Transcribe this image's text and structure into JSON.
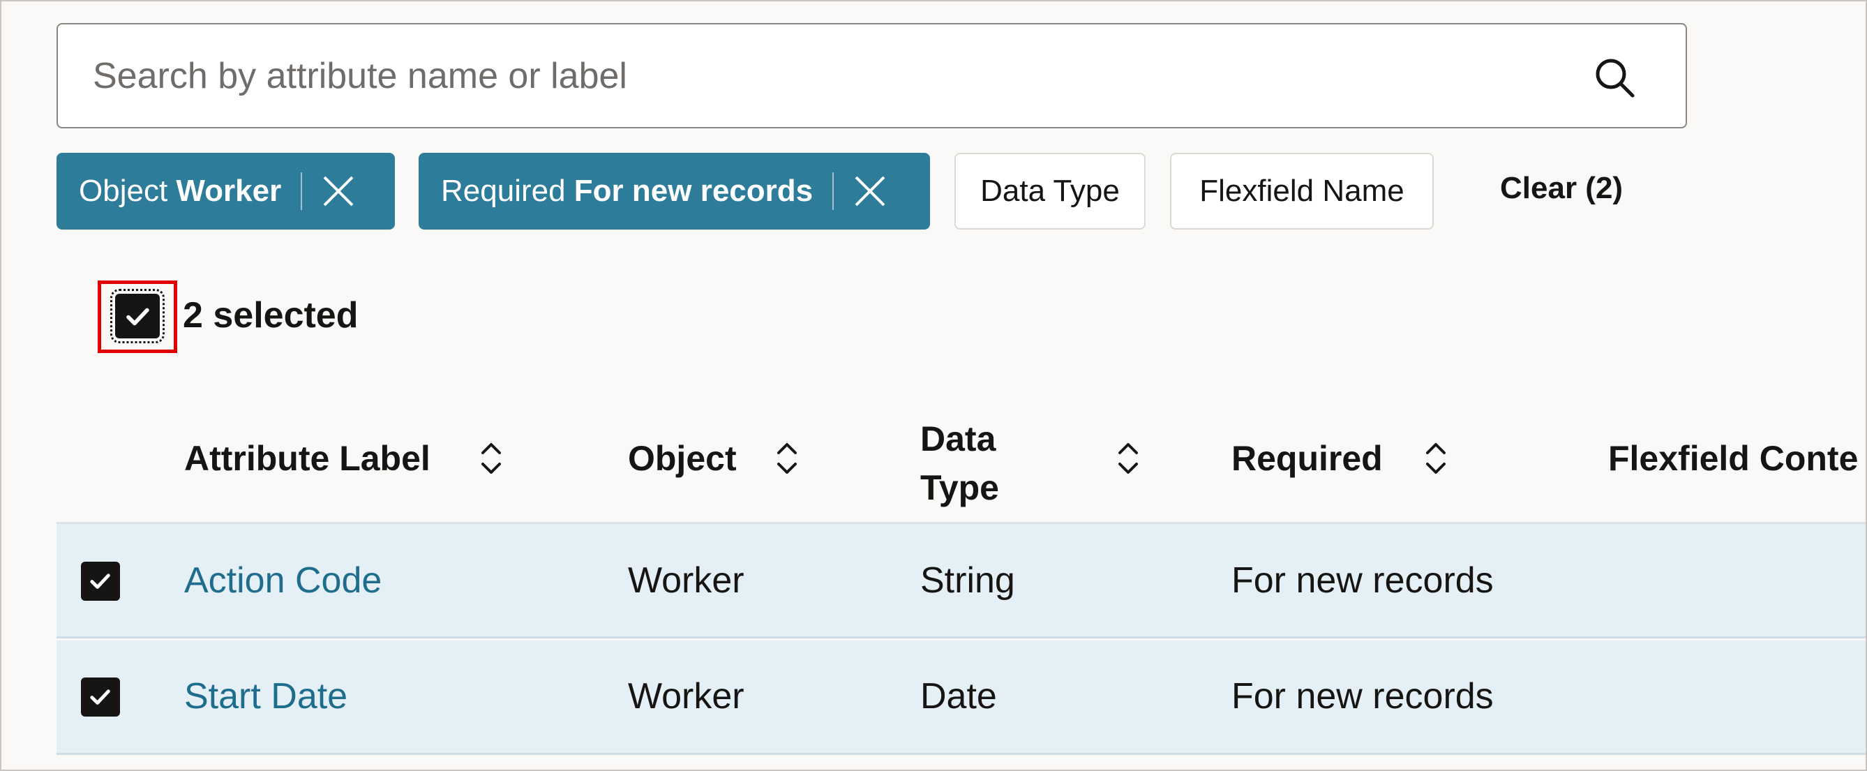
{
  "search": {
    "placeholder": "Search by attribute name or label",
    "icon": "search-icon"
  },
  "filters": {
    "chips": [
      {
        "name": "Object",
        "value": "Worker",
        "active": true
      },
      {
        "name": "Required",
        "value": "For new records",
        "active": true
      },
      {
        "name": "Data Type",
        "active": false
      },
      {
        "name": "Flexfield Name",
        "active": false
      }
    ],
    "clear_label": "Clear (2)"
  },
  "selection": {
    "checked": true,
    "text": "2 selected"
  },
  "table": {
    "columns": [
      {
        "label": "Attribute Label"
      },
      {
        "label": "Object"
      },
      {
        "label_line1": "Data",
        "label_line2": "Type"
      },
      {
        "label": "Required"
      },
      {
        "label": "Flexfield Conte"
      }
    ],
    "rows": [
      {
        "checked": true,
        "attribute_label": "Action Code",
        "object": "Worker",
        "data_type": "String",
        "required": "For new records"
      },
      {
        "checked": true,
        "attribute_label": "Start Date",
        "object": "Worker",
        "data_type": "Date",
        "required": "For new records"
      }
    ]
  },
  "colors": {
    "accent": "#2d7d9a",
    "link": "#1f6d8c",
    "selected_row": "#e4eff6",
    "highlight_box": "#e00000"
  }
}
